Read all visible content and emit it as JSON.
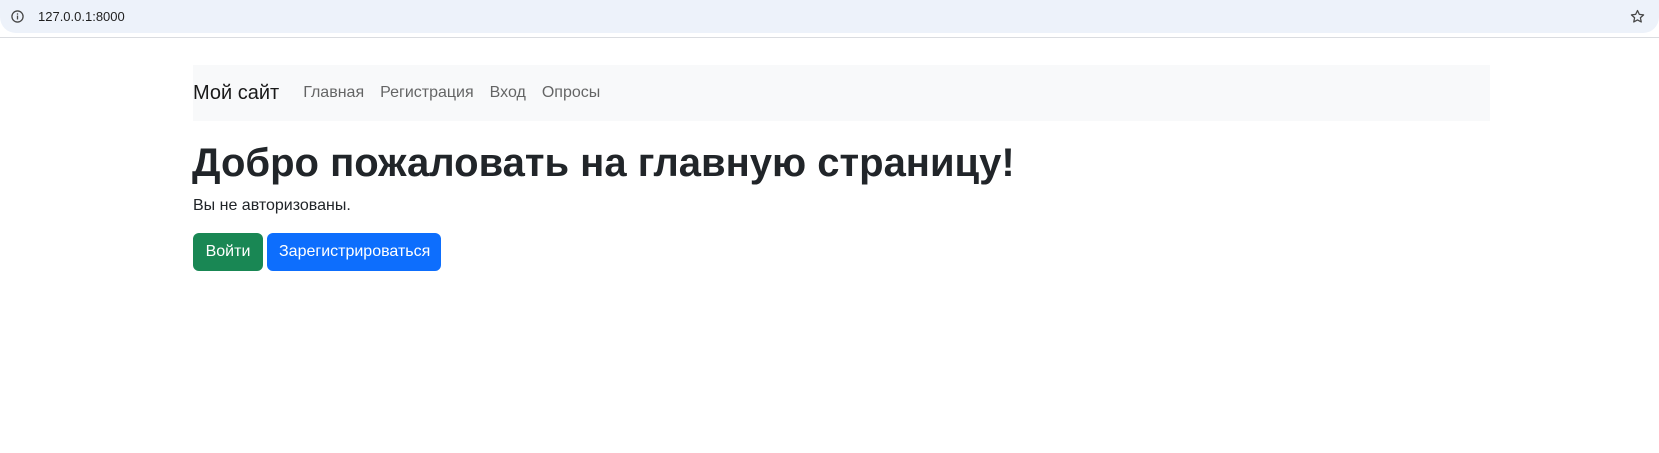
{
  "browser": {
    "url": "127.0.0.1:8000",
    "info_icon": "info-icon",
    "bookmark_icon": "star-icon"
  },
  "navbar": {
    "brand": "Мой сайт",
    "links": [
      "Главная",
      "Регистрация",
      "Вход",
      "Опросы"
    ]
  },
  "main": {
    "title": "Добро пожаловать на главную страницу!",
    "status": "Вы не авторизованы.",
    "login_button": "Войти",
    "register_button": "Зарегистрироваться"
  },
  "colors": {
    "login_button": "#198754",
    "register_button": "#0d6efd",
    "navbar_bg": "#f8f9fa"
  }
}
